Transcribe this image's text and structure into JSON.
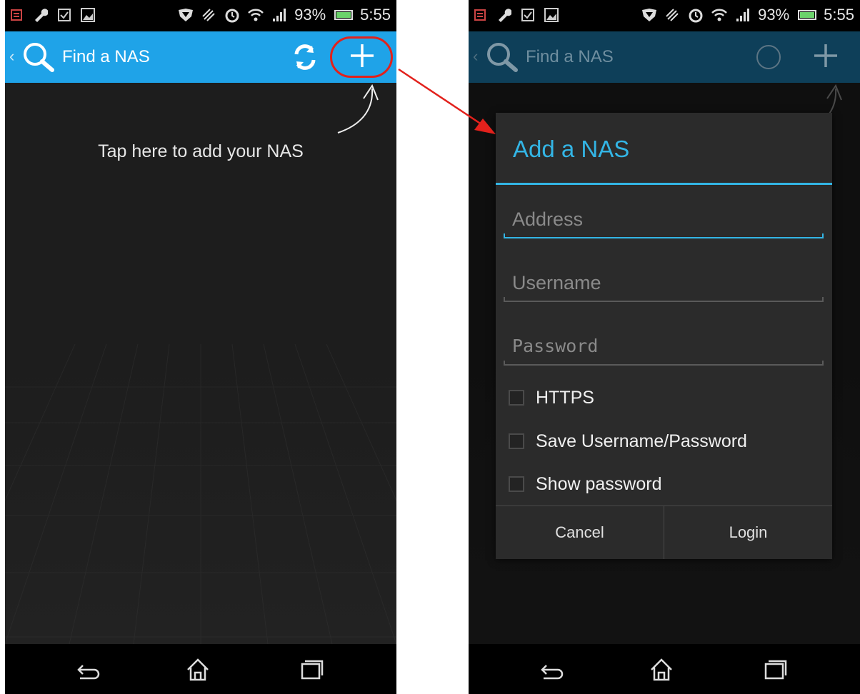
{
  "status_bar": {
    "battery": "93%",
    "time": "5:55"
  },
  "action_bar": {
    "title": "Find a NAS"
  },
  "hint": {
    "text": "Tap here to add your NAS"
  },
  "dialog": {
    "title": "Add a NAS",
    "address_placeholder": "Address",
    "username_placeholder": "Username",
    "password_placeholder": "Password",
    "https_label": "HTTPS",
    "save_label": "Save Username/Password",
    "show_password_label": "Show password",
    "cancel_label": "Cancel",
    "login_label": "Login"
  },
  "colors": {
    "accent": "#33b5e5",
    "action_bar": "#1fa3e8",
    "highlight": "#e2211c"
  }
}
